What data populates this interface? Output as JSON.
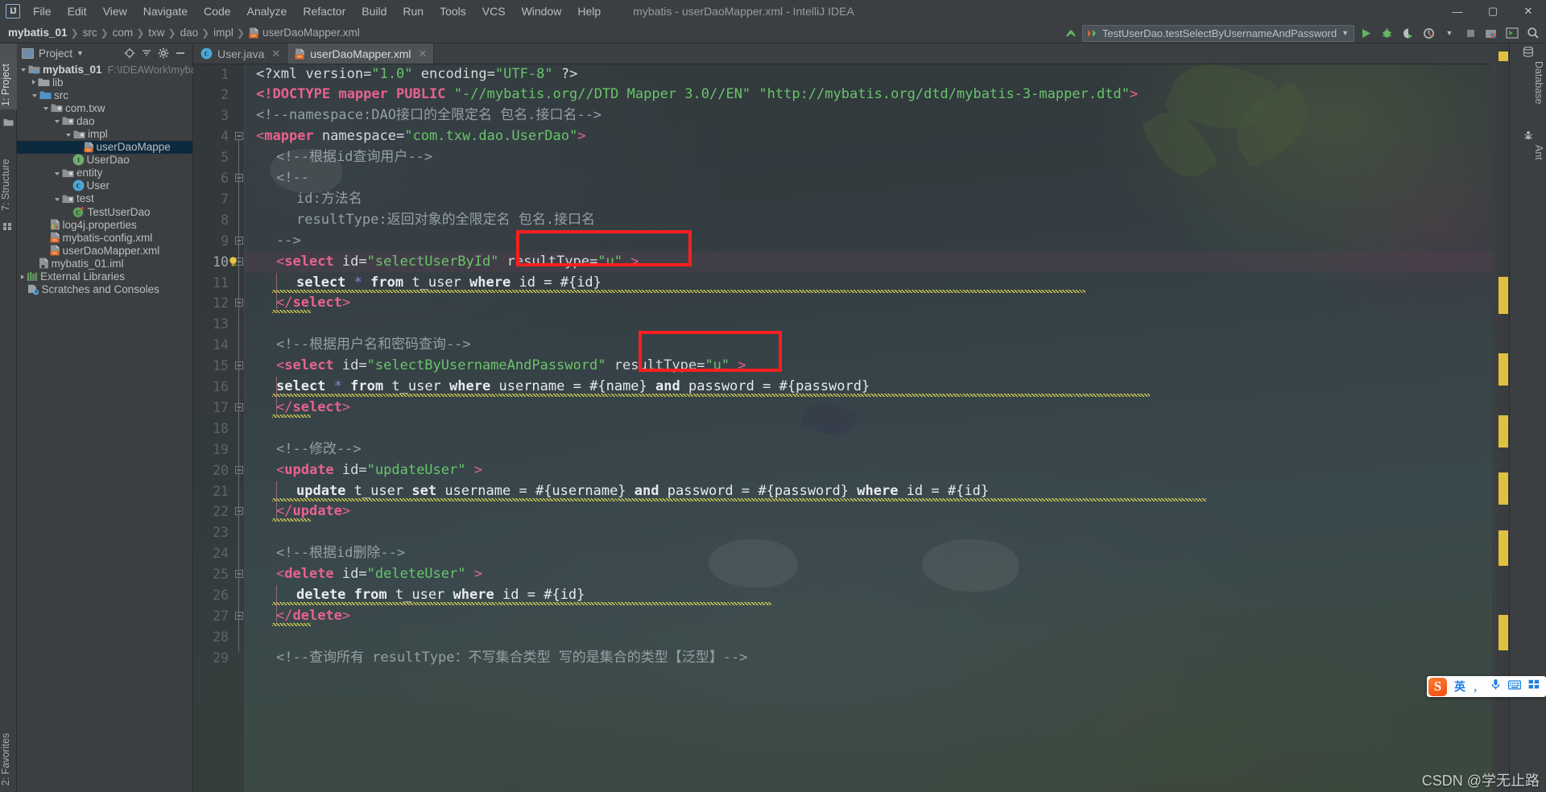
{
  "window": {
    "title": "mybatis - userDaoMapper.xml - IntelliJ IDEA",
    "logo": "IJ",
    "minimize": "—",
    "maximize": "▢",
    "close": "✕"
  },
  "menu": [
    {
      "label": "File"
    },
    {
      "label": "Edit"
    },
    {
      "label": "View"
    },
    {
      "label": "Navigate"
    },
    {
      "label": "Code"
    },
    {
      "label": "Analyze"
    },
    {
      "label": "Refactor"
    },
    {
      "label": "Build"
    },
    {
      "label": "Run"
    },
    {
      "label": "Tools"
    },
    {
      "label": "VCS"
    },
    {
      "label": "Window"
    },
    {
      "label": "Help"
    }
  ],
  "breadcrumbs": [
    {
      "label": "mybatis_01",
      "bold": true
    },
    {
      "label": "src"
    },
    {
      "label": "com"
    },
    {
      "label": "txw"
    },
    {
      "label": "dao"
    },
    {
      "label": "impl"
    },
    {
      "label": "userDaoMapper.xml",
      "icon": "xml-file-icon"
    }
  ],
  "toolbar": {
    "run_config": "TestUserDao.testSelectByUsernameAndPassword",
    "icons": [
      "navigate-up-icon",
      "run-icon",
      "debug-icon",
      "run-coverage-icon",
      "profiler-icon",
      "stop-icon",
      "build-project-icon",
      "terminal-icon",
      "search-everywhere-icon"
    ]
  },
  "left_tool_strip": [
    {
      "label": "1: Project",
      "active": true
    },
    {
      "label": "7: Structure",
      "active": false
    }
  ],
  "right_tool_strip": [
    {
      "label": "Database",
      "icon": "database-icon"
    },
    {
      "label": "Ant",
      "icon": "ant-icon"
    }
  ],
  "project_panel": {
    "title": "Project",
    "tools": [
      "locate-icon",
      "collapse-all-icon",
      "settings-gear-icon",
      "hide-icon"
    ],
    "tree": [
      {
        "label": "mybatis_01",
        "sub": "F:\\IDEAWork\\myba",
        "depth": 0,
        "arrow": "open",
        "icon": "module-icon",
        "bold": true,
        "selected": false
      },
      {
        "label": "lib",
        "sub": "",
        "depth": 1,
        "arrow": "closed",
        "icon": "folder-icon",
        "bold": false,
        "selected": false
      },
      {
        "label": "src",
        "sub": "",
        "depth": 1,
        "arrow": "open",
        "icon": "source-root-icon",
        "bold": false,
        "selected": false
      },
      {
        "label": "com.txw",
        "sub": "",
        "depth": 2,
        "arrow": "open",
        "icon": "package-icon",
        "bold": false,
        "selected": false
      },
      {
        "label": "dao",
        "sub": "",
        "depth": 3,
        "arrow": "open",
        "icon": "package-icon",
        "bold": false,
        "selected": false
      },
      {
        "label": "impl",
        "sub": "",
        "depth": 4,
        "arrow": "open",
        "icon": "package-icon",
        "bold": false,
        "selected": false
      },
      {
        "label": "userDaoMappe",
        "sub": "",
        "depth": 5,
        "arrow": "none",
        "icon": "xml-file-icon",
        "bold": false,
        "selected": true
      },
      {
        "label": "UserDao",
        "sub": "",
        "depth": 4,
        "arrow": "none",
        "icon": "interface-icon",
        "bold": false,
        "selected": false
      },
      {
        "label": "entity",
        "sub": "",
        "depth": 3,
        "arrow": "open",
        "icon": "package-icon",
        "bold": false,
        "selected": false
      },
      {
        "label": "User",
        "sub": "",
        "depth": 4,
        "arrow": "none",
        "icon": "class-icon",
        "bold": false,
        "selected": false
      },
      {
        "label": "test",
        "sub": "",
        "depth": 3,
        "arrow": "open",
        "icon": "package-icon",
        "bold": false,
        "selected": false
      },
      {
        "label": "TestUserDao",
        "sub": "",
        "depth": 4,
        "arrow": "none",
        "icon": "test-class-icon",
        "bold": false,
        "selected": false
      },
      {
        "label": "log4j.properties",
        "sub": "",
        "depth": 2,
        "arrow": "none",
        "icon": "properties-icon",
        "bold": false,
        "selected": false
      },
      {
        "label": "mybatis-config.xml",
        "sub": "",
        "depth": 2,
        "arrow": "none",
        "icon": "xml-file-icon",
        "bold": false,
        "selected": false
      },
      {
        "label": "userDaoMapper.xml",
        "sub": "",
        "depth": 2,
        "arrow": "none",
        "icon": "xml-file-icon",
        "bold": false,
        "selected": false
      },
      {
        "label": "mybatis_01.iml",
        "sub": "",
        "depth": 1,
        "arrow": "none",
        "icon": "iml-file-icon",
        "bold": false,
        "selected": false
      },
      {
        "label": "External Libraries",
        "sub": "",
        "depth": 0,
        "arrow": "closed",
        "icon": "libraries-icon",
        "bold": false,
        "selected": false
      },
      {
        "label": "Scratches and Consoles",
        "sub": "",
        "depth": 0,
        "arrow": "none",
        "icon": "scratches-icon",
        "bold": false,
        "selected": false
      }
    ]
  },
  "editor_tabs": [
    {
      "label": "User.java",
      "icon": "class-icon",
      "active": false
    },
    {
      "label": "userDaoMapper.xml",
      "icon": "xml-file-icon",
      "active": true
    }
  ],
  "editor": {
    "current_line": 10,
    "lines": [
      {
        "n": 1,
        "indent": 0,
        "text": "<?xml version=\"1.0\" encoding=\"UTF-8\" ?>"
      },
      {
        "n": 2,
        "indent": 0,
        "text": "<!DOCTYPE mapper PUBLIC \"-//mybatis.org//DTD Mapper 3.0//EN\" \"http://mybatis.org/dtd/mybatis-3-mapper.dtd\">"
      },
      {
        "n": 3,
        "indent": 0,
        "text": "<!--namespace:DAO接口的全限定名 包名.接口名-->"
      },
      {
        "n": 4,
        "indent": 0,
        "text": "<mapper namespace=\"com.txw.dao.UserDao\">"
      },
      {
        "n": 5,
        "indent": 1,
        "text": "<!--根据id查询用户-->"
      },
      {
        "n": 6,
        "indent": 1,
        "text": "<!--"
      },
      {
        "n": 7,
        "indent": 2,
        "text": "id:方法名"
      },
      {
        "n": 8,
        "indent": 2,
        "text": "resultType:返回对象的全限定名 包名.接口名"
      },
      {
        "n": 9,
        "indent": 1,
        "text": "-->"
      },
      {
        "n": 10,
        "indent": 1,
        "text": "<select id=\"selectUserById\" resultType=\"u\" >"
      },
      {
        "n": 11,
        "indent": 2,
        "text": "select * from t_user where id = #{id}"
      },
      {
        "n": 12,
        "indent": 1,
        "text": "</select>"
      },
      {
        "n": 13,
        "indent": 0,
        "text": ""
      },
      {
        "n": 14,
        "indent": 1,
        "text": "<!--根据用户名和密码查询-->"
      },
      {
        "n": 15,
        "indent": 1,
        "text": "<select id=\"selectByUsernameAndPassword\" resultType=\"u\" >"
      },
      {
        "n": 16,
        "indent": 1,
        "text": "select * from t_user where username = #{name} and password = #{password}"
      },
      {
        "n": 17,
        "indent": 1,
        "text": "</select>"
      },
      {
        "n": 18,
        "indent": 0,
        "text": ""
      },
      {
        "n": 19,
        "indent": 1,
        "text": "<!--修改-->"
      },
      {
        "n": 20,
        "indent": 1,
        "text": "<update id=\"updateUser\" >"
      },
      {
        "n": 21,
        "indent": 2,
        "text": "update t_user set username = #{username} and password = #{password} where id = #{id}"
      },
      {
        "n": 22,
        "indent": 1,
        "text": "</update>"
      },
      {
        "n": 23,
        "indent": 0,
        "text": ""
      },
      {
        "n": 24,
        "indent": 1,
        "text": "<!--根据id删除-->"
      },
      {
        "n": 25,
        "indent": 1,
        "text": "<delete id=\"deleteUser\" >"
      },
      {
        "n": 26,
        "indent": 2,
        "text": "delete from t_user where id = #{id}"
      },
      {
        "n": 27,
        "indent": 1,
        "text": "</delete>"
      },
      {
        "n": 28,
        "indent": 0,
        "text": ""
      },
      {
        "n": 29,
        "indent": 1,
        "text": "<!--查询所有 resultType：不写集合类型 写的是集合的类型【泛型】-->"
      }
    ],
    "annotations": [
      {
        "name": "result-type-highlight-1",
        "label": "resultType=\"u\"",
        "line": 10
      },
      {
        "name": "result-type-highlight-2",
        "label": "resultType=\"u\"",
        "line": 15
      }
    ],
    "colors": {
      "tag": "#e8628e",
      "attribute_value": "#6ac46a",
      "comment": "#95a0a4",
      "text": "#d6dadd",
      "annotation_box": "#fb1f1f",
      "warning_squiggle": "#cfc94f",
      "current_line": "#533e4d",
      "selection": "#0d293e"
    }
  },
  "ime": {
    "logo": "S",
    "mode": "英",
    "punct": "，",
    "icons": [
      "microphone-icon",
      "keyboard-icon",
      "apps-icon"
    ]
  },
  "watermark": "CSDN @学无止路"
}
